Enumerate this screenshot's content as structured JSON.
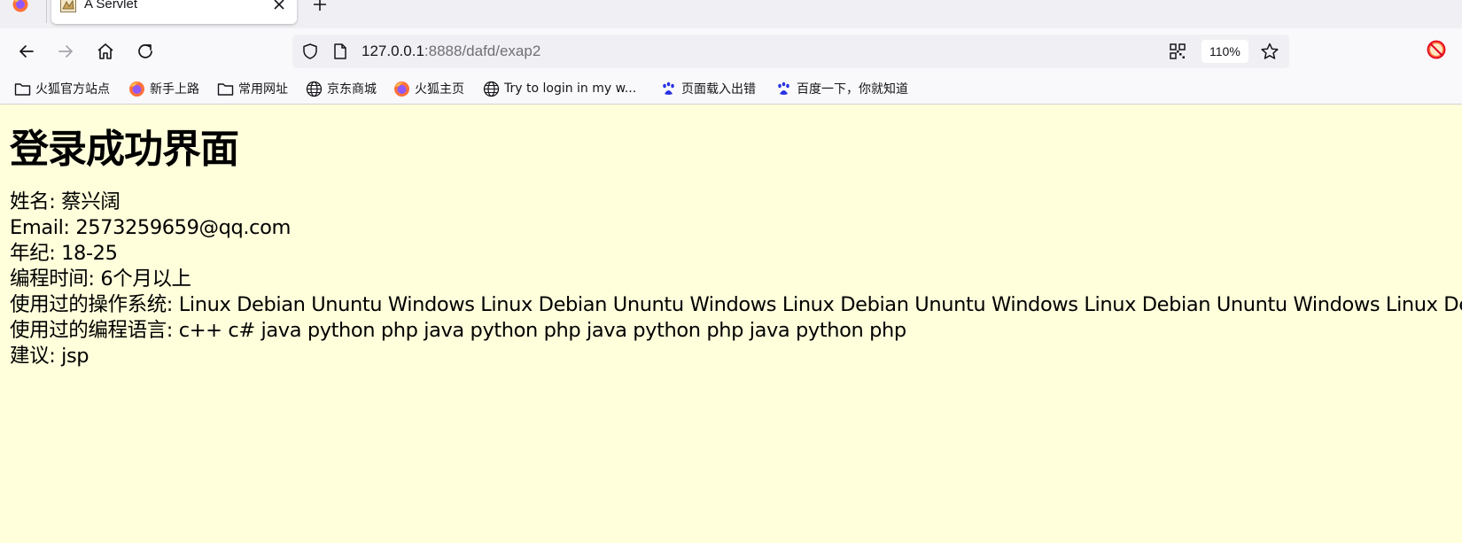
{
  "tab": {
    "title": "A Servlet"
  },
  "address_bar": {
    "host": "127.0.0.1",
    "rest": ":8888/dafd/exap2",
    "zoom": "110%"
  },
  "bookmarks": [
    {
      "label": "火狐官方站点",
      "icon": "folder-icon"
    },
    {
      "label": "新手上路",
      "icon": "firefox-icon"
    },
    {
      "label": "常用网址",
      "icon": "folder-icon"
    },
    {
      "label": "京东商城",
      "icon": "globe-icon"
    },
    {
      "label": "火狐主页",
      "icon": "firefox-icon"
    },
    {
      "label": "Try to login in my w...",
      "icon": "globe-icon"
    },
    {
      "label": "页面载入出错",
      "icon": "baidu-icon"
    },
    {
      "label": "百度一下，你就知道",
      "icon": "baidu-icon"
    }
  ],
  "page": {
    "heading": "登录成功界面",
    "lines": [
      "姓名: 蔡兴阔",
      "Email: 2573259659@qq.com",
      "年纪: 18-25",
      "编程时间: 6个月以上",
      "使用过的操作系统: Linux Debian Ununtu Windows Linux Debian Ununtu Windows Linux Debian Ununtu Windows Linux Debian Ununtu Windows Linux Debian",
      "使用过的编程语言: c++ c# java python php java python php java python php java python php",
      "建议: jsp"
    ]
  },
  "colors": {
    "page_bg": "#ffffdc",
    "chrome_bg": "#f9f9fb",
    "tabstrip_bg": "#f0f0f4"
  }
}
